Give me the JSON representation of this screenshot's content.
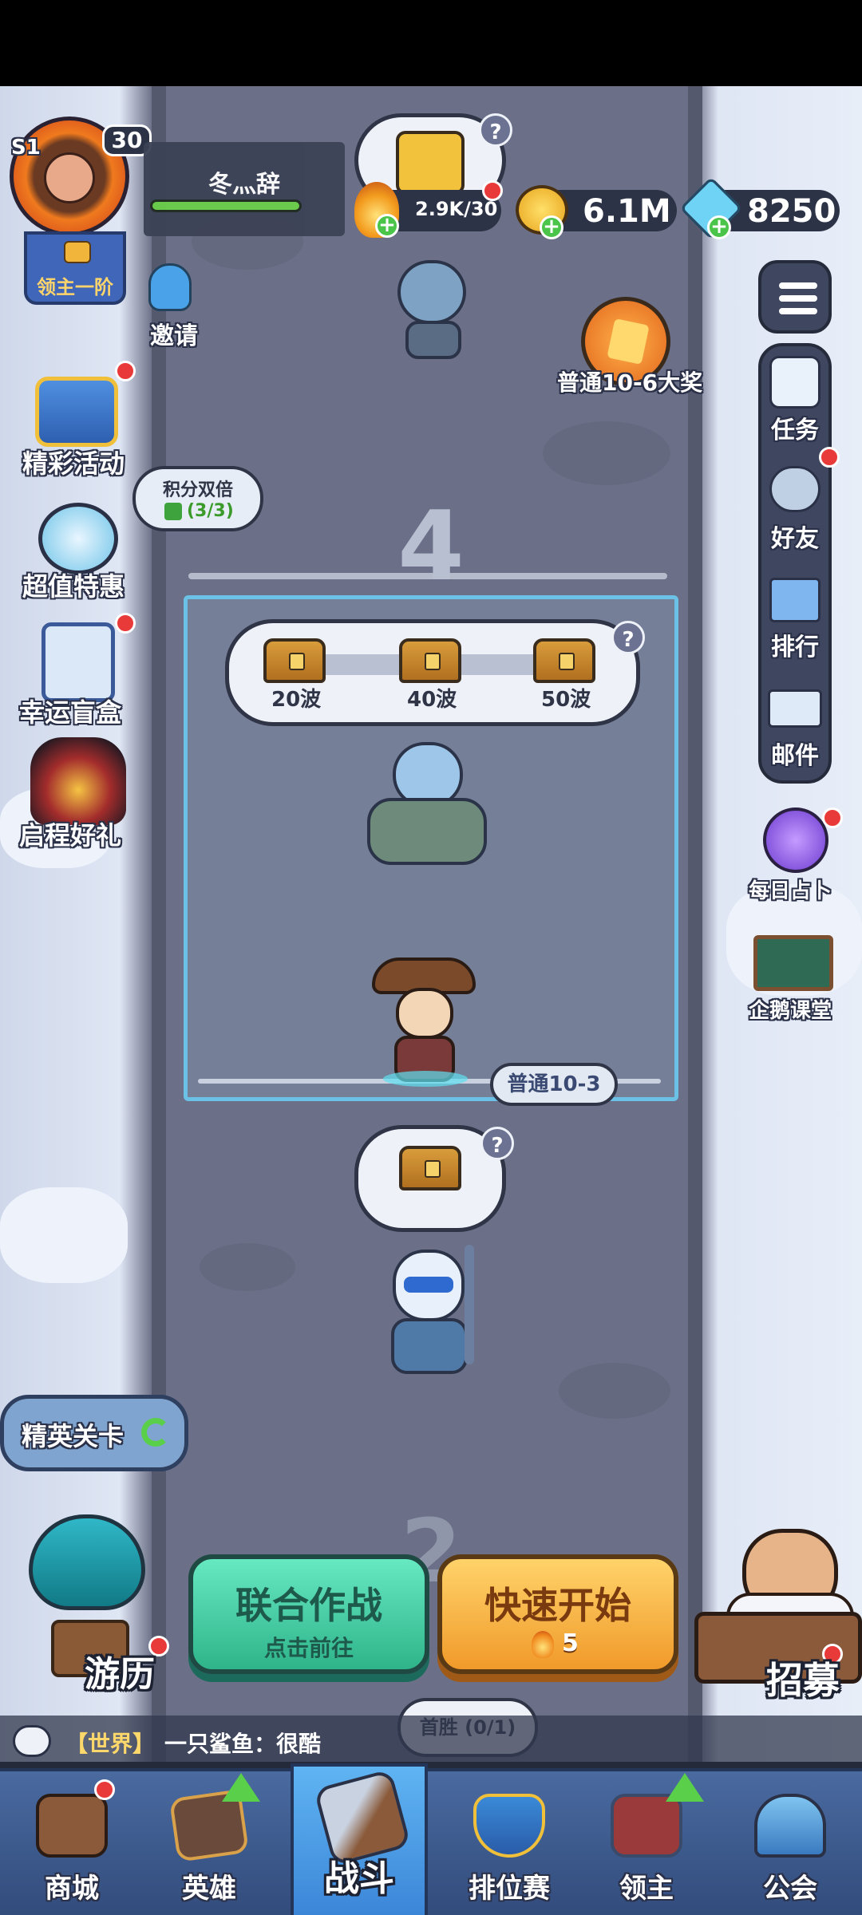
{
  "player": {
    "season": "S1",
    "level": "30",
    "name": "冬灬辞",
    "rank_title": "领主一阶"
  },
  "resources": {
    "stamina": "2.9K/30",
    "gold": "6.1M",
    "gems": "8250"
  },
  "left_menu": {
    "invite": "邀请",
    "events": "精彩活动",
    "double_points_title": "积分双倍",
    "double_points_count": "(3/3)",
    "deals": "超值特惠",
    "lucky_box": "幸运盲盒",
    "journey_gift": "启程好礼",
    "elite_stage": "精英关卡",
    "travel": "游历"
  },
  "right_menu": {
    "tasks": "任务",
    "friends": "好友",
    "ranking": "排行",
    "mail": "邮件",
    "daily_divination": "每日占卜",
    "penguin_class": "企鹅课堂",
    "recruit": "招募"
  },
  "stage": {
    "big_reward": "普通10-6大奖",
    "next_chapter_number": "4",
    "waves": [
      "20波",
      "40波",
      "50波"
    ],
    "current_stage": "普通10-3",
    "lower_chapter_number": "2",
    "first_win": "首胜 (0/1)"
  },
  "actions": {
    "joint_battle_title": "联合作战",
    "joint_battle_sub": "点击前往",
    "quick_start_title": "快速开始",
    "quick_start_cost": "5"
  },
  "chat": {
    "channel": "【世界】",
    "message": "一只鲨鱼：很酷"
  },
  "nav": [
    "商城",
    "英雄",
    "战斗",
    "排位赛",
    "领主",
    "公会"
  ],
  "colors": {
    "accent_green": "#3ecfa0",
    "accent_orange": "#f4b13a",
    "stage_border": "#6cc2e6",
    "nav_bg": "#3d5a8a"
  }
}
